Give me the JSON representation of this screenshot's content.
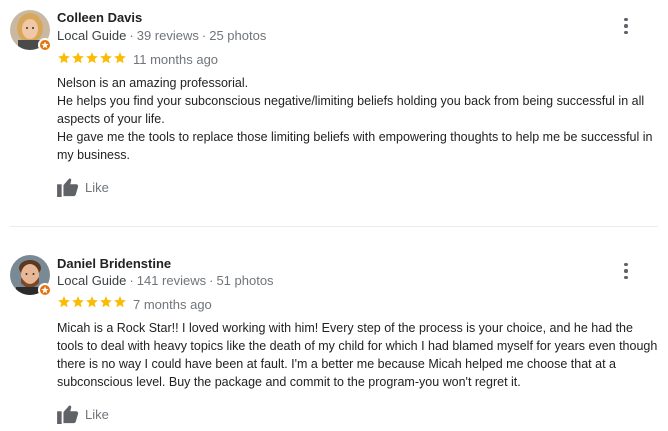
{
  "reviews": [
    {
      "name": "Colleen Davis",
      "local_guide": "Local Guide",
      "review_count": "39 reviews",
      "photo_count": "25 photos",
      "rating": 5,
      "time": "11 months ago",
      "text": [
        "Nelson is an amazing professorial.",
        "He helps you find your subconscious negative/limiting beliefs holding you back from being successful in all aspects of your life.",
        "He gave me the tools to replace those limiting beliefs with empowering thoughts to help me be successful in my business."
      ],
      "like_label": "Like"
    },
    {
      "name": "Daniel Bridenstine",
      "local_guide": "Local Guide",
      "review_count": "141 reviews",
      "photo_count": "51 photos",
      "rating": 5,
      "time": "7 months ago",
      "text": [
        "Micah is a Rock Star!! I loved working with him! Every step of the process is your choice, and he had the tools to deal with heavy topics like the death of my child for which I had blamed myself for years even though there is no way I could have been at fault.  I'm a better me because Micah helped me choose that at a subconscious level.  Buy the package and commit to the program-you won't regret it."
      ],
      "like_label": "Like"
    }
  ],
  "colors": {
    "star": "#fbbc04",
    "badge": "#e8710a",
    "meta_text": "#70757a",
    "icon": "#5f6368"
  },
  "icons": {
    "more": "more-vert-icon",
    "like": "thumb-up-icon",
    "star": "star-icon",
    "badge": "local-guide-badge-icon"
  },
  "separator": "·"
}
